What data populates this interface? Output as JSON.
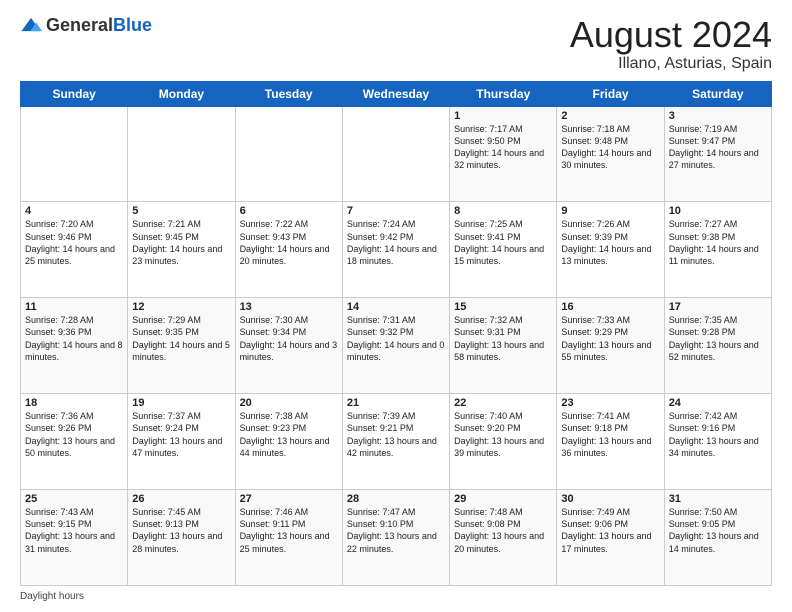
{
  "header": {
    "logo_general": "General",
    "logo_blue": "Blue",
    "month_title": "August 2024",
    "location": "Illano, Asturias, Spain"
  },
  "days_of_week": [
    "Sunday",
    "Monday",
    "Tuesday",
    "Wednesday",
    "Thursday",
    "Friday",
    "Saturday"
  ],
  "weeks": [
    [
      {
        "day": "",
        "info": ""
      },
      {
        "day": "",
        "info": ""
      },
      {
        "day": "",
        "info": ""
      },
      {
        "day": "",
        "info": ""
      },
      {
        "day": "1",
        "sunrise": "Sunrise: 7:17 AM",
        "sunset": "Sunset: 9:50 PM",
        "daylight": "Daylight: 14 hours and 32 minutes."
      },
      {
        "day": "2",
        "sunrise": "Sunrise: 7:18 AM",
        "sunset": "Sunset: 9:48 PM",
        "daylight": "Daylight: 14 hours and 30 minutes."
      },
      {
        "day": "3",
        "sunrise": "Sunrise: 7:19 AM",
        "sunset": "Sunset: 9:47 PM",
        "daylight": "Daylight: 14 hours and 27 minutes."
      }
    ],
    [
      {
        "day": "4",
        "sunrise": "Sunrise: 7:20 AM",
        "sunset": "Sunset: 9:46 PM",
        "daylight": "Daylight: 14 hours and 25 minutes."
      },
      {
        "day": "5",
        "sunrise": "Sunrise: 7:21 AM",
        "sunset": "Sunset: 9:45 PM",
        "daylight": "Daylight: 14 hours and 23 minutes."
      },
      {
        "day": "6",
        "sunrise": "Sunrise: 7:22 AM",
        "sunset": "Sunset: 9:43 PM",
        "daylight": "Daylight: 14 hours and 20 minutes."
      },
      {
        "day": "7",
        "sunrise": "Sunrise: 7:24 AM",
        "sunset": "Sunset: 9:42 PM",
        "daylight": "Daylight: 14 hours and 18 minutes."
      },
      {
        "day": "8",
        "sunrise": "Sunrise: 7:25 AM",
        "sunset": "Sunset: 9:41 PM",
        "daylight": "Daylight: 14 hours and 15 minutes."
      },
      {
        "day": "9",
        "sunrise": "Sunrise: 7:26 AM",
        "sunset": "Sunset: 9:39 PM",
        "daylight": "Daylight: 14 hours and 13 minutes."
      },
      {
        "day": "10",
        "sunrise": "Sunrise: 7:27 AM",
        "sunset": "Sunset: 9:38 PM",
        "daylight": "Daylight: 14 hours and 11 minutes."
      }
    ],
    [
      {
        "day": "11",
        "sunrise": "Sunrise: 7:28 AM",
        "sunset": "Sunset: 9:36 PM",
        "daylight": "Daylight: 14 hours and 8 minutes."
      },
      {
        "day": "12",
        "sunrise": "Sunrise: 7:29 AM",
        "sunset": "Sunset: 9:35 PM",
        "daylight": "Daylight: 14 hours and 5 minutes."
      },
      {
        "day": "13",
        "sunrise": "Sunrise: 7:30 AM",
        "sunset": "Sunset: 9:34 PM",
        "daylight": "Daylight: 14 hours and 3 minutes."
      },
      {
        "day": "14",
        "sunrise": "Sunrise: 7:31 AM",
        "sunset": "Sunset: 9:32 PM",
        "daylight": "Daylight: 14 hours and 0 minutes."
      },
      {
        "day": "15",
        "sunrise": "Sunrise: 7:32 AM",
        "sunset": "Sunset: 9:31 PM",
        "daylight": "Daylight: 13 hours and 58 minutes."
      },
      {
        "day": "16",
        "sunrise": "Sunrise: 7:33 AM",
        "sunset": "Sunset: 9:29 PM",
        "daylight": "Daylight: 13 hours and 55 minutes."
      },
      {
        "day": "17",
        "sunrise": "Sunrise: 7:35 AM",
        "sunset": "Sunset: 9:28 PM",
        "daylight": "Daylight: 13 hours and 52 minutes."
      }
    ],
    [
      {
        "day": "18",
        "sunrise": "Sunrise: 7:36 AM",
        "sunset": "Sunset: 9:26 PM",
        "daylight": "Daylight: 13 hours and 50 minutes."
      },
      {
        "day": "19",
        "sunrise": "Sunrise: 7:37 AM",
        "sunset": "Sunset: 9:24 PM",
        "daylight": "Daylight: 13 hours and 47 minutes."
      },
      {
        "day": "20",
        "sunrise": "Sunrise: 7:38 AM",
        "sunset": "Sunset: 9:23 PM",
        "daylight": "Daylight: 13 hours and 44 minutes."
      },
      {
        "day": "21",
        "sunrise": "Sunrise: 7:39 AM",
        "sunset": "Sunset: 9:21 PM",
        "daylight": "Daylight: 13 hours and 42 minutes."
      },
      {
        "day": "22",
        "sunrise": "Sunrise: 7:40 AM",
        "sunset": "Sunset: 9:20 PM",
        "daylight": "Daylight: 13 hours and 39 minutes."
      },
      {
        "day": "23",
        "sunrise": "Sunrise: 7:41 AM",
        "sunset": "Sunset: 9:18 PM",
        "daylight": "Daylight: 13 hours and 36 minutes."
      },
      {
        "day": "24",
        "sunrise": "Sunrise: 7:42 AM",
        "sunset": "Sunset: 9:16 PM",
        "daylight": "Daylight: 13 hours and 34 minutes."
      }
    ],
    [
      {
        "day": "25",
        "sunrise": "Sunrise: 7:43 AM",
        "sunset": "Sunset: 9:15 PM",
        "daylight": "Daylight: 13 hours and 31 minutes."
      },
      {
        "day": "26",
        "sunrise": "Sunrise: 7:45 AM",
        "sunset": "Sunset: 9:13 PM",
        "daylight": "Daylight: 13 hours and 28 minutes."
      },
      {
        "day": "27",
        "sunrise": "Sunrise: 7:46 AM",
        "sunset": "Sunset: 9:11 PM",
        "daylight": "Daylight: 13 hours and 25 minutes."
      },
      {
        "day": "28",
        "sunrise": "Sunrise: 7:47 AM",
        "sunset": "Sunset: 9:10 PM",
        "daylight": "Daylight: 13 hours and 22 minutes."
      },
      {
        "day": "29",
        "sunrise": "Sunrise: 7:48 AM",
        "sunset": "Sunset: 9:08 PM",
        "daylight": "Daylight: 13 hours and 20 minutes."
      },
      {
        "day": "30",
        "sunrise": "Sunrise: 7:49 AM",
        "sunset": "Sunset: 9:06 PM",
        "daylight": "Daylight: 13 hours and 17 minutes."
      },
      {
        "day": "31",
        "sunrise": "Sunrise: 7:50 AM",
        "sunset": "Sunset: 9:05 PM",
        "daylight": "Daylight: 13 hours and 14 minutes."
      }
    ]
  ],
  "footer": {
    "note": "Daylight hours"
  }
}
